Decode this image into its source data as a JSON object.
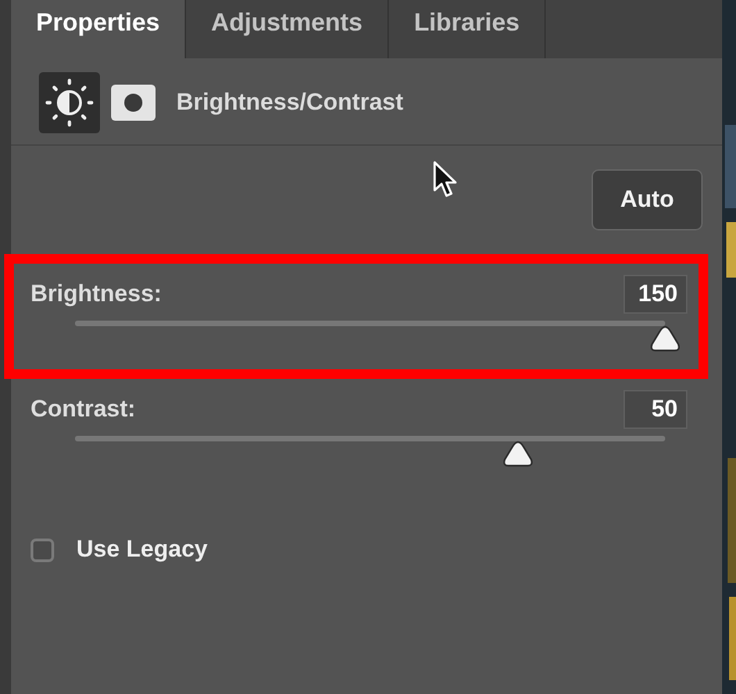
{
  "tabs": [
    {
      "label": "Properties",
      "selected": true
    },
    {
      "label": "Adjustments",
      "selected": false
    },
    {
      "label": "Libraries",
      "selected": false
    }
  ],
  "header": {
    "title": "Brightness/Contrast"
  },
  "auto_button": "Auto",
  "sliders": [
    {
      "label": "Brightness:",
      "value": "150",
      "level": 1,
      "highlighted": true
    },
    {
      "label": "Contrast:",
      "value": "50",
      "level": 0.75,
      "highlighted": false
    }
  ],
  "checkboxes": [
    {
      "label": "Use Legacy",
      "checked": false
    }
  ]
}
